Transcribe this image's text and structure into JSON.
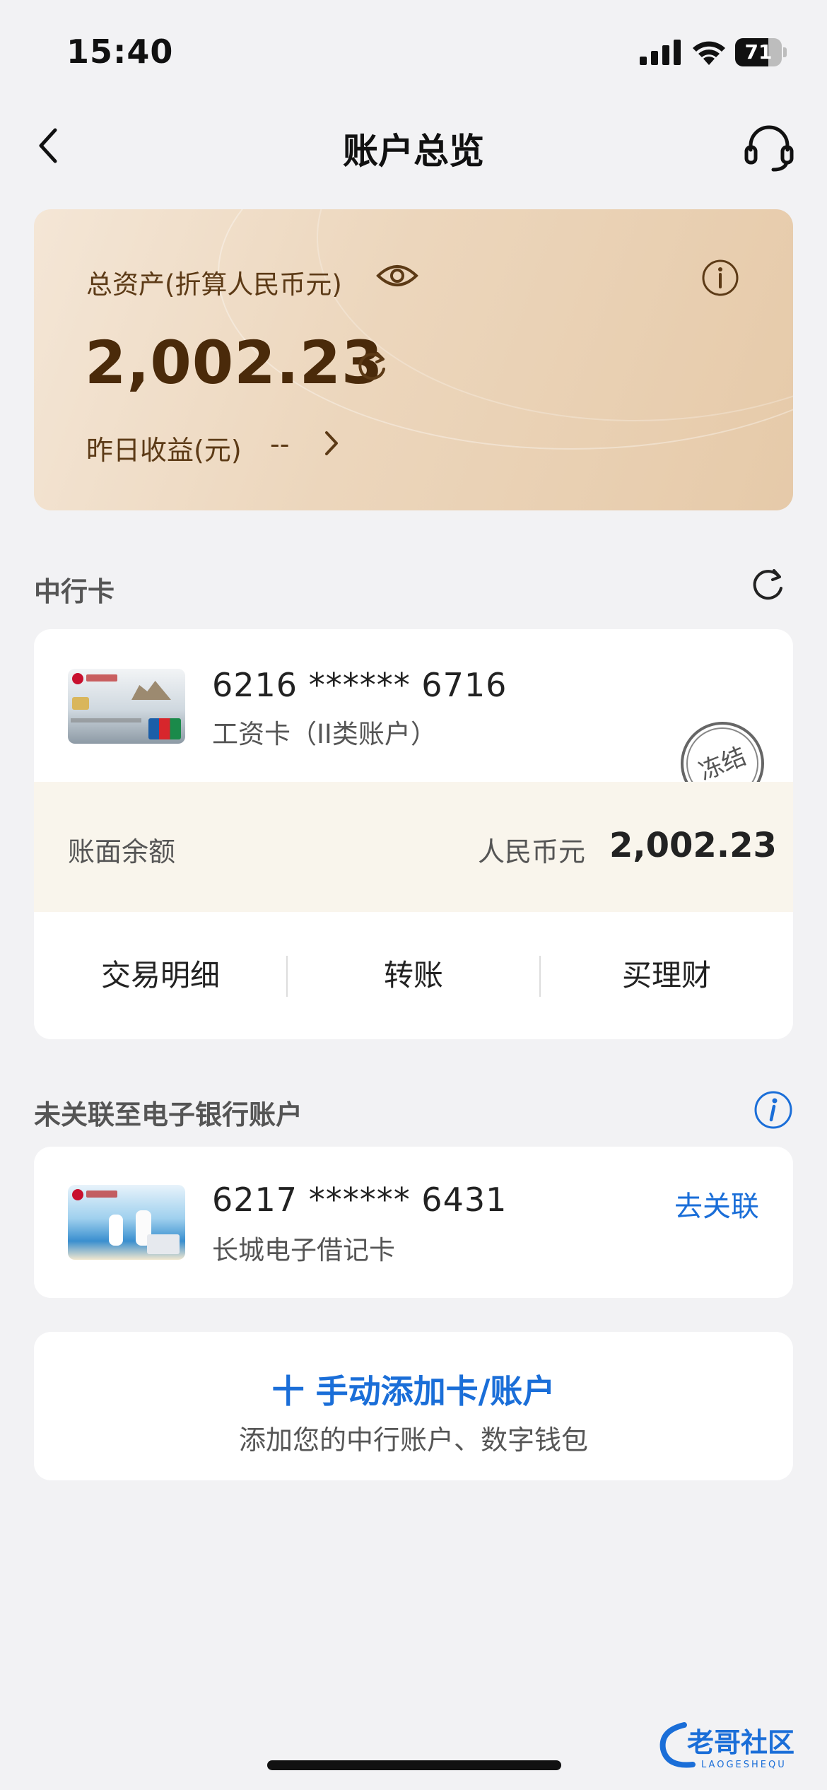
{
  "status_bar": {
    "time": "15:40",
    "battery": "71",
    "battery_level": 0.71
  },
  "nav": {
    "title": "账户总览"
  },
  "asset_card": {
    "label": "总资产(折算人民币元)",
    "amount": "2,002.23",
    "yesterday_label": "昨日收益(元)",
    "yesterday_value": "--"
  },
  "section_boc": {
    "title": "中行卡"
  },
  "card1": {
    "number": "6216 ****** 6716",
    "type": "工资卡（II类账户）",
    "stamp": "冻结",
    "balance_label": "账面余额",
    "currency": "人民币元",
    "balance": "2,002.23",
    "actions": [
      "交易明细",
      "转账",
      "买理财"
    ]
  },
  "section_unlinked": {
    "title": "未关联至电子银行账户"
  },
  "card2": {
    "number": "6217 ****** 6431",
    "type": "长城电子借记卡",
    "link": "去关联"
  },
  "add_card": {
    "title": "十 手动添加卡/账户",
    "subtitle": "添加您的中行账户、数字钱包"
  },
  "watermark": {
    "text": "老哥社区",
    "sub": "LAOGESHEQU"
  },
  "colors": {
    "accent": "#1a6ed8",
    "gold_text": "#5c3a16",
    "card_bg": "#ecd6bc"
  }
}
